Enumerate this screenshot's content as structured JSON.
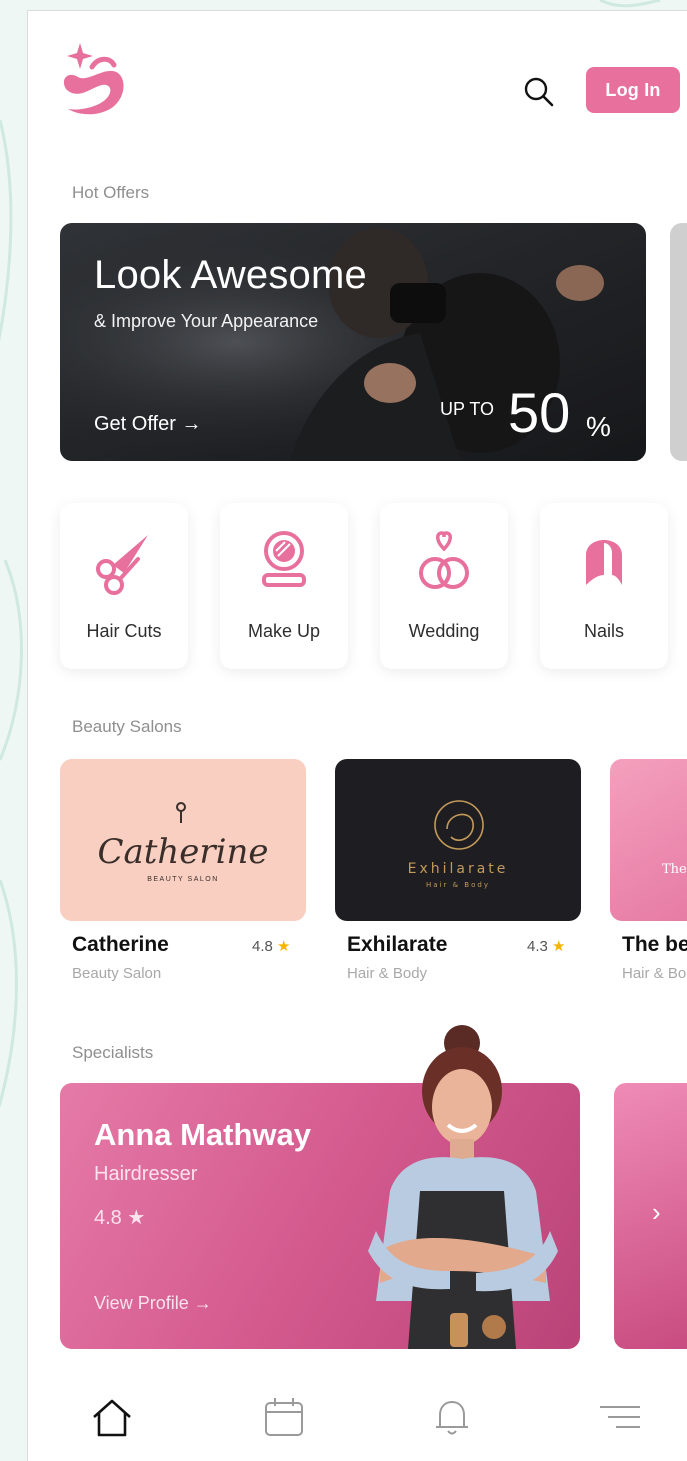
{
  "header": {
    "login_label": "Log In"
  },
  "sections": {
    "hot_offers": "Hot Offers",
    "beauty_salons": "Beauty Salons",
    "specialists": "Specialists"
  },
  "offer": {
    "title": "Look Awesome",
    "subtitle": "& Improve Your Appearance",
    "cta": "Get Offer →",
    "upto": "UP TO",
    "value": "50",
    "unit": "%"
  },
  "categories": [
    {
      "label": "Hair Cuts",
      "icon": "scissors-icon"
    },
    {
      "label": "Make Up",
      "icon": "compact-mirror-icon"
    },
    {
      "label": "Wedding",
      "icon": "rings-icon"
    },
    {
      "label": "Nails",
      "icon": "nail-icon"
    }
  ],
  "salons": [
    {
      "name": "Catherine",
      "rating": "4.8",
      "subtitle": "Beauty Salon",
      "logo_text": "Catherine",
      "logo_sub": "BEAUTY SALON"
    },
    {
      "name": "Exhilarate",
      "rating": "4.3",
      "subtitle": "Hair & Body",
      "logo_text": "Exhilarate",
      "logo_sub": "Hair & Body"
    },
    {
      "name": "The be",
      "subtitle": "Hair & Bo",
      "logo_text": "The"
    }
  ],
  "rating_star": "★",
  "specialist": {
    "name": "Anna Mathway",
    "role": "Hairdresser",
    "rating": "4.8",
    "cta": "View Profile  →",
    "next": "›"
  },
  "bottom_nav": [
    "home-icon",
    "calendar-icon",
    "bell-icon",
    "menu-icon"
  ],
  "colors": {
    "accent": "#e8709c",
    "star": "#f5b400",
    "background": "#ffffff"
  }
}
